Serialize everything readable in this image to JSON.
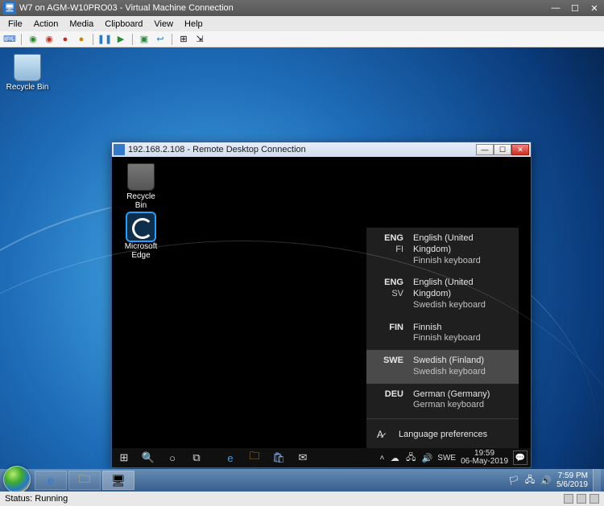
{
  "vm": {
    "title": "W7 on AGM-W10PRO03 - Virtual Machine Connection",
    "menu": [
      "File",
      "Action",
      "Media",
      "Clipboard",
      "View",
      "Help"
    ],
    "status": "Status: Running"
  },
  "outer_desktop": {
    "icons": [
      {
        "label": "Recycle Bin"
      }
    ]
  },
  "outer_taskbar": {
    "tray_time": "7:59 PM",
    "tray_date": "5/6/2019"
  },
  "rdp": {
    "title": "192.168.2.108 - Remote Desktop Connection",
    "icons": [
      {
        "label": "Recycle Bin"
      },
      {
        "label": "Microsoft Edge"
      }
    ]
  },
  "lang_panel": {
    "items": [
      {
        "code": "ENG",
        "sub": "FI",
        "name": "English (United Kingdom)",
        "kbd": "Finnish keyboard",
        "hl": false
      },
      {
        "code": "ENG",
        "sub": "SV",
        "name": "English (United Kingdom)",
        "kbd": "Swedish keyboard",
        "hl": false
      },
      {
        "code": "FIN",
        "sub": "",
        "name": "Finnish",
        "kbd": "Finnish keyboard",
        "hl": false
      },
      {
        "code": "SWE",
        "sub": "",
        "name": "Swedish (Finland)",
        "kbd": "Swedish keyboard",
        "hl": true
      },
      {
        "code": "DEU",
        "sub": "",
        "name": "German (Germany)",
        "kbd": "German keyboard",
        "hl": false
      }
    ],
    "pref_label": "Language preferences"
  },
  "inner_taskbar": {
    "lang": "SWE",
    "time": "19:59",
    "date": "06-May-2019"
  }
}
